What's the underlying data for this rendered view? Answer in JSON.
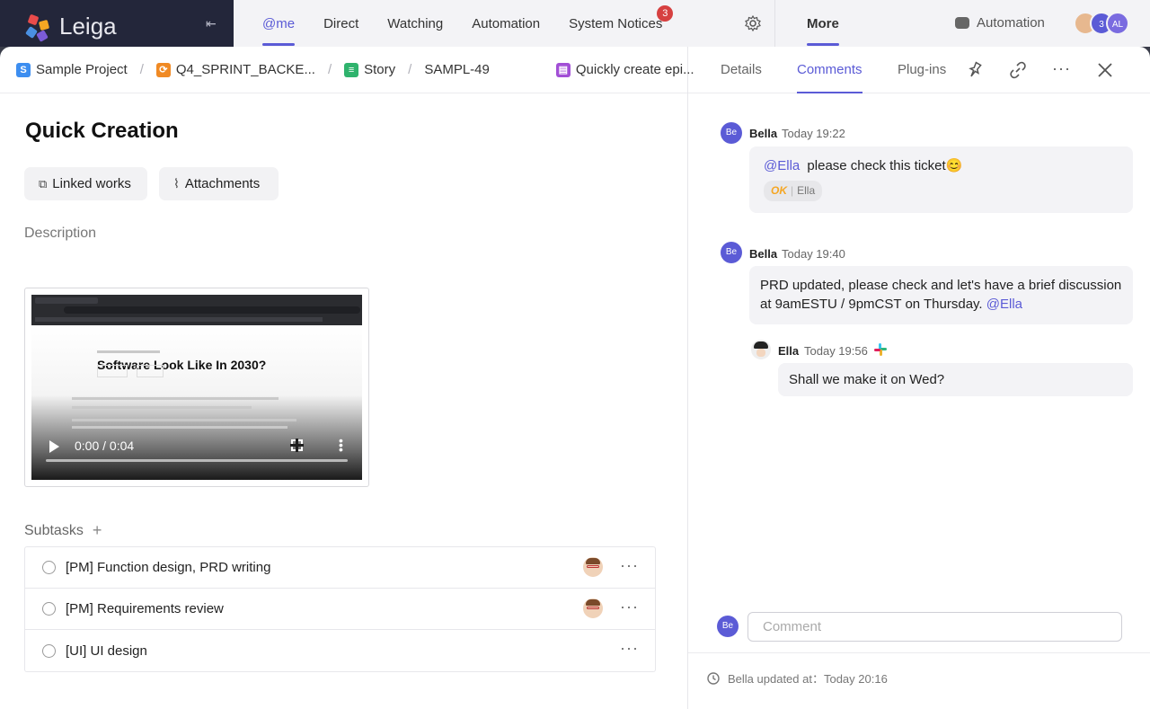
{
  "app": {
    "logo_text": "Leiga",
    "nav": [
      "@me",
      "Direct",
      "Watching",
      "Automation",
      "System Notices"
    ],
    "notice_count": "3",
    "more": "More",
    "automation": "Automation",
    "avatars": [
      "",
      "3",
      "AL"
    ]
  },
  "breadcrumb": {
    "project": "Sample Project",
    "sprint": "Q4_SPRINT_BACKE...",
    "type": "Story",
    "key": "SAMPL-49",
    "parent": "Quickly create epi..."
  },
  "issue": {
    "title": "Quick Creation",
    "linked_works": "Linked works",
    "attachments": "Attachments",
    "description_label": "Description",
    "video": {
      "headline": "Software Look Like In 2030?",
      "time": "0:00 / 0:04"
    },
    "subtasks_label": "Subtasks",
    "subtasks_add": "+",
    "subtasks": [
      {
        "title": "[PM] Function design, PRD writing",
        "assigned": true
      },
      {
        "title": "[PM] Requirements review",
        "assigned": true
      },
      {
        "title": "[UI] UI design",
        "assigned": false
      }
    ]
  },
  "panel": {
    "tabs": [
      "Details",
      "Comments",
      "Plug-ins"
    ],
    "comments": [
      {
        "avatar": "Be",
        "author": "Bella",
        "time": "Today 19:22",
        "mention": "@Ella",
        "text": "please check this ticket",
        "emoji": "😊",
        "reaction_label": "OK",
        "reaction_user": "Ella"
      },
      {
        "avatar": "Be",
        "author": "Bella",
        "time": "Today 19:40",
        "text": "PRD updated, please check and let's have a brief discussion at 9amESTU / 9pmCST on Thursday.",
        "mention": "@Ella"
      },
      {
        "author": "Ella",
        "time": "Today 19:56",
        "text": "Shall we make it on Wed?"
      }
    ],
    "composer_avatar": "Be",
    "comment_placeholder": "Comment",
    "updated_text": "Bella updated at：Today 20:16"
  }
}
